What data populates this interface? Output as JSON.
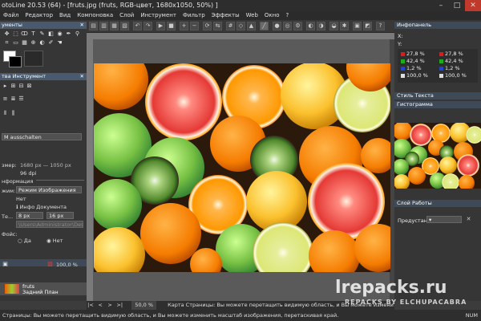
{
  "window": {
    "title": "otoLine 20.53 (64) - [fruts.jpg (fruts, RGB-цвет, 1680x1050, 50%) ]",
    "min": "–",
    "max": "□",
    "close": "✕"
  },
  "menu": [
    "Файл",
    "Редактор",
    "Вид",
    "Компоновка",
    "Слой",
    "Инструмент",
    "Фильтр",
    "Эффекты",
    "Web",
    "Окно",
    "?"
  ],
  "left": {
    "tools_title": "ументы",
    "tool_settings_title": "тва Инструмент",
    "dropdown_value": "M ausschalten",
    "doc_size_label": "змер:",
    "doc_size_value": "1680 px — 1050 px",
    "resolution": "96 dpi",
    "info_label": "нформация",
    "mode_label": "жим:",
    "mode_value": "Режим Изображения",
    "status_value": "Нет",
    "doc_info": "Инфо Документа",
    "te_label": "Те...",
    "val1": "8 px",
    "val2": "16 px",
    "path_text": "\\Users\\Administrator\\Desktop\\fru",
    "files_label": "Фойс:",
    "yes": "Да",
    "no": "Нет",
    "opacity": "100,0 %",
    "layer_name": "fruts",
    "layer_sub": "Задний План"
  },
  "right": {
    "info_title": "Инфопанель",
    "x_label": "X:",
    "y_label": "Y:",
    "r1": "27,8 %",
    "g1": "42,4 %",
    "b1": "1,2 %",
    "a1": "100,0 %",
    "r2": "27,8 %",
    "g2": "42,4 %",
    "b2": "1,2 %",
    "a2": "100,0 %",
    "text_style_title": "Стиль Текста",
    "histogram_title": "Гистограмма",
    "workspace_title": "Слой Работы",
    "preset_label": "Предустан.:"
  },
  "nav": {
    "zoom": "50,0 %",
    "message": "Карта Страницы: Вы можете перетащить видимую область, и Вы можете изменить масштаб изображения"
  },
  "status": {
    "text": "Страницы: Вы можете перетащить видимую область, и Вы можете изменить масштаб изображения, перетаскивая край.",
    "num": "NUM"
  },
  "watermark": {
    "main": "lrepacks.ru",
    "sub": "REPACKS BY ELCHUPACABRA"
  },
  "colors": {
    "accent_title": "#4a5a6e",
    "red": "#cc2222",
    "green": "#22aa22",
    "blue": "#2244cc"
  }
}
